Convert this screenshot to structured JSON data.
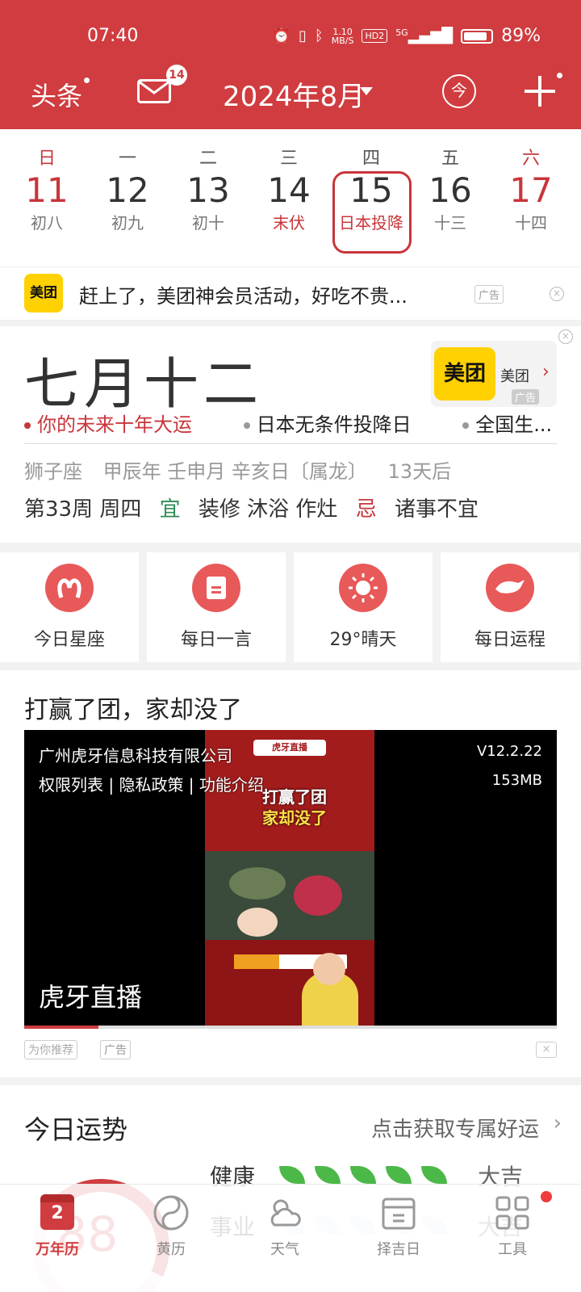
{
  "status_bar": {
    "time": "07:40",
    "net_speed_top": "1.10",
    "net_speed_unit": "MB/S",
    "hd": "HD2",
    "signal": "5G",
    "battery": "89%"
  },
  "header": {
    "news_label": "头条",
    "mail_badge": "14",
    "month": "2024年8月",
    "today_label": "今"
  },
  "week": {
    "days": [
      {
        "dow": "日",
        "num": "11",
        "lunar": "初八",
        "weekend": true
      },
      {
        "dow": "一",
        "num": "12",
        "lunar": "初九"
      },
      {
        "dow": "二",
        "num": "13",
        "lunar": "初十"
      },
      {
        "dow": "三",
        "num": "14",
        "lunar": "末伏",
        "festival": true
      },
      {
        "dow": "四",
        "num": "15",
        "lunar": "日本投降",
        "selected": true
      },
      {
        "dow": "五",
        "num": "16",
        "lunar": "十三"
      },
      {
        "dow": "六",
        "num": "17",
        "lunar": "十四",
        "weekend": true
      }
    ]
  },
  "ad_row": {
    "logo": "美团",
    "text": "赶上了，美团神会员活动，好吃不贵...",
    "tag": "广告"
  },
  "info": {
    "lunar_date": "七月十二",
    "ad_logo": "美团",
    "ad_name": "美团",
    "ad_tag": "广告",
    "tags": [
      "你的未来十年大运",
      "日本无条件投降日",
      "全国生..."
    ],
    "zodiac": "狮子座",
    "ganzhi": "甲辰年 壬申月 辛亥日〔属龙〕",
    "countdown": "13天后",
    "week": "第33周 周四",
    "yi_label": "宜",
    "yi": "装修 沐浴 作灶",
    "ji_label": "忌",
    "ji": "诸事不宜"
  },
  "shortcuts": [
    {
      "label": "今日星座",
      "icon": "aries-icon"
    },
    {
      "label": "每日一言",
      "icon": "note-icon"
    },
    {
      "label": "29°晴天",
      "icon": "sun-icon"
    },
    {
      "label": "每日运程",
      "icon": "dragon-icon"
    }
  ],
  "feed": {
    "title": "打赢了团，家却没了",
    "company": "广州虎牙信息科技有限公司",
    "links": "权限列表 | 隐私政策 | 功能介绍",
    "version": "V12.2.22",
    "size": "153MB",
    "brand": "虎牙直播",
    "video_logo": "虎牙直播",
    "video_caption_1": "打赢了团",
    "video_caption_2": "家却没了",
    "progress": 0.14,
    "rec_label": "为你推荐",
    "ad_label": "广告"
  },
  "fortune": {
    "title": "今日运势",
    "link": "点击获取专属好运",
    "score": "88",
    "rows": [
      {
        "name": "健康",
        "filled": 5,
        "result": "大吉"
      },
      {
        "name": "事业",
        "filled": 0,
        "result": "大吉"
      }
    ]
  },
  "nav": [
    {
      "label": "万年历",
      "badge_num": "2",
      "active": true
    },
    {
      "label": "黄历"
    },
    {
      "label": "天气"
    },
    {
      "label": "择吉日"
    },
    {
      "label": "工具"
    }
  ],
  "colors": {
    "primary": "#d03c3f",
    "meituan": "#ffd100",
    "yi": "#2e8b57"
  }
}
